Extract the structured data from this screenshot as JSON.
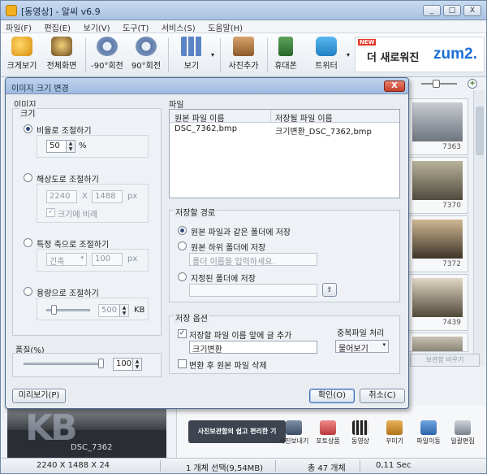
{
  "app": {
    "title": "[동영상] - 알씨 v6.9",
    "window_buttons": [
      "_",
      "□",
      "X"
    ]
  },
  "menu": [
    "파일(F)",
    "편집(E)",
    "보기(V)",
    "도구(T)",
    "서비스(S)",
    "도움말(H)"
  ],
  "toolbar": {
    "items": [
      {
        "label": "크게보기",
        "icon": "magnifier-icon"
      },
      {
        "label": "전체화면",
        "icon": "fullscreen-icon"
      },
      {
        "label": "-90°회전",
        "icon": "rotate-left-icon"
      },
      {
        "label": "90°회전",
        "icon": "rotate-right-icon"
      },
      {
        "label": "보기",
        "icon": "view-grid-icon"
      },
      {
        "label": "사진추가",
        "icon": "add-photo-icon"
      },
      {
        "label": "휴대폰",
        "icon": "phone-export-icon"
      },
      {
        "label": "트위터",
        "icon": "twitter-icon"
      }
    ],
    "banner": {
      "new_badge": "NEW",
      "text": "더 새로워진",
      "brand": "zum2."
    }
  },
  "browser": {
    "thumbnails": [
      {
        "label": "7363"
      },
      {
        "label": "7370"
      },
      {
        "label": "7372"
      },
      {
        "label": "7439"
      },
      {
        "label": ""
      }
    ],
    "ghost_button": "보관함 비우기",
    "bottom_preview_name": "DSC_7362",
    "promo_text": "사진보관함의 쉽고 편리한 기",
    "bottom_tools": [
      "사진보내기",
      "포토상품",
      "동영상",
      "꾸미기",
      "파일이동",
      "일괄편집"
    ]
  },
  "status": {
    "dimensions": "2240 X 1488 X 24",
    "selection": "1 개체 선택(9,54MB)",
    "total": "총 47 개체",
    "time": "0,11 Sec"
  },
  "dialog": {
    "title": "이미지 크기 변경",
    "close_label": "X",
    "image_section": "이미지",
    "size_section": "크기",
    "ratio": {
      "label": "비율로 조절하기",
      "value": "50",
      "unit": "%",
      "selected": true
    },
    "resolution": {
      "label": "해상도로 조절하기",
      "width": "2240",
      "x": "X",
      "height": "1488",
      "unit": "px",
      "keep_ratio": "크기에 비례",
      "selected": false
    },
    "axis": {
      "label": "특정 축으로 조절하기",
      "axis_value": "긴축",
      "value": "100",
      "unit": "px",
      "selected": false
    },
    "capacity": {
      "label": "용량으로 조절하기",
      "value": "500",
      "unit": "KB",
      "selected": false
    },
    "quality": {
      "label": "품질(%)",
      "value": "100"
    },
    "file_section": "파일",
    "file_table": {
      "headers": [
        "원본 파일 이름",
        "저장될 파일 이름"
      ],
      "rows": [
        [
          "DSC_7362,bmp",
          "크기변환_DSC_7362,bmp"
        ]
      ]
    },
    "save_path": {
      "section": "저장할 경로",
      "same_folder": "원본 파일과 같은 폴더에 저장",
      "sub_folder": "원본 하위 폴더에 저장",
      "sub_folder_placeholder": "폴더 이름을 입력하세요.",
      "specified_folder": "지정된 폴더에 저장",
      "selected": "same_folder"
    },
    "save_options": {
      "section": "저장 옵션",
      "add_prefix": "저장할 파일 이름 앞에 글 추가",
      "prefix_value": "크기변환_",
      "delete_original": "변환 후 원본 파일 삭제",
      "duplicate_section": "중복파일 처리",
      "duplicate_value": "물어보기"
    },
    "preview_button": "미리보기(P)",
    "ok_button": "확인(O)",
    "cancel_button": "취소(C)"
  }
}
